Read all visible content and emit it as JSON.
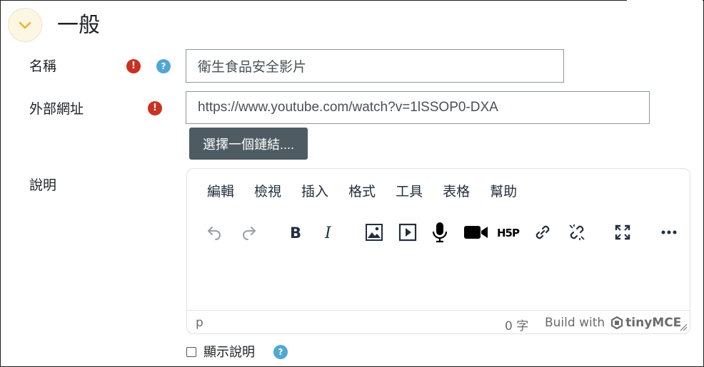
{
  "section": {
    "title": "一般"
  },
  "fields": {
    "name": {
      "label": "名稱",
      "value": "衛生食品安全影片"
    },
    "external_url": {
      "label": "外部網址",
      "value": "https://www.youtube.com/watch?v=1lSSOP0-DXA"
    },
    "choose_link_label": "選擇一個鏈結....",
    "description": {
      "label": "說明"
    }
  },
  "icons": {
    "required": "!",
    "help": "?"
  },
  "editor": {
    "menu": [
      "編輯",
      "檢視",
      "插入",
      "格式",
      "工具",
      "表格",
      "幫助"
    ],
    "toolbar": [
      "undo",
      "redo",
      "bold",
      "italic",
      "image",
      "media",
      "record-audio",
      "record-video",
      "h5p",
      "link",
      "unlink",
      "fullscreen",
      "more"
    ],
    "path": "p",
    "word_count": "0 字",
    "branding_prefix": "Build with",
    "branding_name": "tinyMCE"
  },
  "show_description": {
    "label": "顯示說明",
    "checked": false
  },
  "colors": {
    "required": "#ca3120",
    "help": "#50a7d4",
    "button": "#4e5b62",
    "collapse_bg": "#fdf6e3",
    "chevron": "#f0b429"
  }
}
